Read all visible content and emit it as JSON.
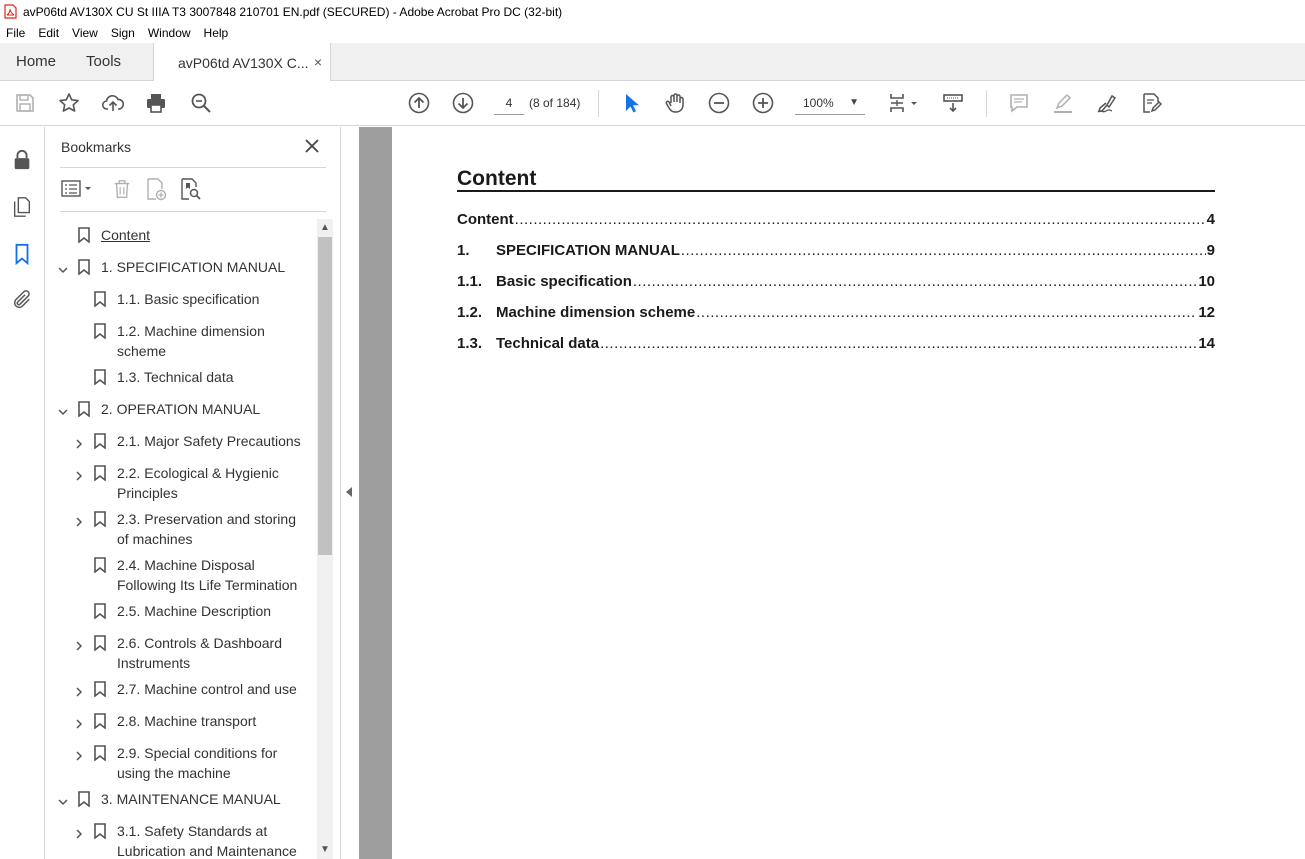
{
  "window": {
    "title": "avP06td AV130X CU St IIIA T3 3007848 210701 EN.pdf (SECURED) - Adobe Acrobat Pro DC (32-bit)"
  },
  "menu": [
    "File",
    "Edit",
    "View",
    "Sign",
    "Window",
    "Help"
  ],
  "tabs": {
    "home": "Home",
    "tools": "Tools",
    "document": "avP06td AV130X C...",
    "close_glyph": "×"
  },
  "toolbar": {
    "page_current": "4",
    "page_of": "(8 of 184)",
    "zoom": "100%",
    "icons": [
      "save-icon",
      "star-icon",
      "upload-icon",
      "print-icon",
      "zoom-search-icon",
      "page-up-icon",
      "page-down-icon",
      "select-arrow-icon",
      "hand-icon",
      "zoom-out-icon",
      "zoom-in-icon",
      "page-fit-icon",
      "scroll-mode-icon",
      "comment-icon",
      "highlight-icon",
      "sign-icon",
      "fill-sign-icon"
    ]
  },
  "rail": [
    "lock-icon",
    "pages-icon",
    "bookmark-icon",
    "attachment-icon"
  ],
  "bookmarks": {
    "header": "Bookmarks",
    "items": [
      {
        "label": "Content",
        "level": 0,
        "chevron": "none",
        "underline": true
      },
      {
        "label": "1. SPECIFICATION MANUAL",
        "level": 0,
        "chevron": "down"
      },
      {
        "label": "1.1. Basic specification",
        "level": 1,
        "chevron": "none"
      },
      {
        "label": "1.2. Machine dimension",
        "label2": "scheme",
        "level": 1,
        "chevron": "none"
      },
      {
        "label": "1.3. Technical data",
        "level": 1,
        "chevron": "none"
      },
      {
        "label": "2. OPERATION MANUAL",
        "level": 0,
        "chevron": "down"
      },
      {
        "label": "2.1. Major Safety Precautions",
        "level": 1,
        "chevron": "right"
      },
      {
        "label": "2.2. Ecological & Hygienic",
        "label2": "Principles",
        "level": 1,
        "chevron": "right"
      },
      {
        "label": "2.3. Preservation and storing",
        "label2": "of machines",
        "level": 1,
        "chevron": "right"
      },
      {
        "label": "2.4. Machine Disposal",
        "label2": "Following Its Life Termination",
        "level": 1,
        "chevron": "none"
      },
      {
        "label": "2.5. Machine Description",
        "level": 1,
        "chevron": "none"
      },
      {
        "label": "2.6. Controls & Dashboard",
        "label2": "Instruments",
        "level": 1,
        "chevron": "right"
      },
      {
        "label": "2.7. Machine control and use",
        "level": 1,
        "chevron": "right"
      },
      {
        "label": "2.8. Machine transport",
        "level": 1,
        "chevron": "right"
      },
      {
        "label": "2.9. Special conditions for",
        "label2": "using the machine",
        "level": 1,
        "chevron": "right"
      },
      {
        "label": "3. MAINTENANCE MANUAL",
        "level": 0,
        "chevron": "down"
      },
      {
        "label": "3.1. Safety Standards at",
        "label2": "Lubrication and Maintenance",
        "level": 1,
        "chevron": "right"
      }
    ]
  },
  "document": {
    "title": "Content",
    "toc": [
      {
        "num": "",
        "label": "Content",
        "page": "4"
      },
      {
        "num": "1.",
        "label": "SPECIFICATION MANUAL",
        "page": "9"
      },
      {
        "num": "1.1.",
        "label": "Basic specification",
        "page": "10"
      },
      {
        "num": "1.2.",
        "label": "Machine dimension scheme",
        "page": "12"
      },
      {
        "num": "1.3.",
        "label": "Technical data",
        "page": "14"
      }
    ]
  },
  "colors": {
    "accent_blue": "#1473e6",
    "pdf_red": "#e0251b",
    "icon_gray": "#555555",
    "disabled_gray": "#b0b0b0"
  }
}
